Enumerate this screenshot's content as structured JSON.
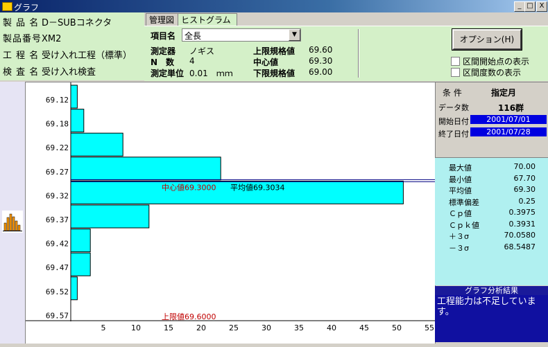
{
  "window": {
    "title": "グラフ",
    "min": "_",
    "max": "□",
    "close": "X"
  },
  "product": {
    "name_label": "製 品 名",
    "name_value": "D－SUBコネクタ",
    "number_label": "製品番号",
    "number_value": "XM2",
    "process_label": "工 程 名",
    "process_value": "受け入れ工程（標準）",
    "inspection_label": "検 査 名",
    "inspection_value": "受け入れ検査"
  },
  "tabs": [
    {
      "label": "管理図"
    },
    {
      "label": "ヒストグラム"
    }
  ],
  "measure": {
    "item_label": "項目名",
    "item_value": "全長",
    "instrument_label": "測定器",
    "instrument_value": "ノギス",
    "n_label": "N　数",
    "n_value": "4",
    "unit_label": "測定単位",
    "unit_value": "0.01　ｍｍ",
    "upper_label": "上限規格値",
    "upper_value": "69.60",
    "center_label": "中心値",
    "center_value": "69.30",
    "lower_label": "下限規格値",
    "lower_value": "69.00"
  },
  "options": {
    "button": "オプション(H)",
    "check1": "区間開始点の表示",
    "check2": "区間度数の表示"
  },
  "conditions": {
    "cond_label": "条 件",
    "cond_value": "指定月",
    "count_label": "データ数",
    "count_value": "116群",
    "start_label": "開始日付",
    "start_value": "2001/07/01",
    "end_label": "終了日付",
    "end_value": "2001/07/28"
  },
  "stats": [
    {
      "label": "最大値",
      "value": "70.00"
    },
    {
      "label": "最小値",
      "value": "67.70"
    },
    {
      "label": "平均値",
      "value": "69.30"
    },
    {
      "label": "標準偏差",
      "value": "0.25"
    },
    {
      "label": "Ｃｐ値",
      "value": "0.3975"
    },
    {
      "label": "Ｃｐｋ値",
      "value": "0.3931"
    },
    {
      "label": "＋３σ",
      "value": "70.0580"
    },
    {
      "label": "－３σ",
      "value": "68.5487"
    }
  ],
  "analysis": {
    "header": "グラフ分析結果",
    "text": "工程能力は不足しています。"
  },
  "chart_data": {
    "type": "bar",
    "orientation": "horizontal",
    "categories": [
      "69.12",
      "69.18",
      "69.22",
      "69.27",
      "69.32",
      "69.37",
      "69.42",
      "69.47",
      "69.52",
      "69.57"
    ],
    "values": [
      1,
      2,
      8,
      23,
      51,
      12,
      3,
      3,
      1,
      0
    ],
    "xticks": [
      5,
      10,
      15,
      20,
      25,
      30,
      35,
      40,
      45,
      50,
      55
    ],
    "xlim": [
      0,
      56
    ],
    "bar_color": "#00ffff",
    "center_label": "中心値69.3000",
    "mean_label": "平均値69.3034",
    "upper_label": "上限値69.6000"
  }
}
